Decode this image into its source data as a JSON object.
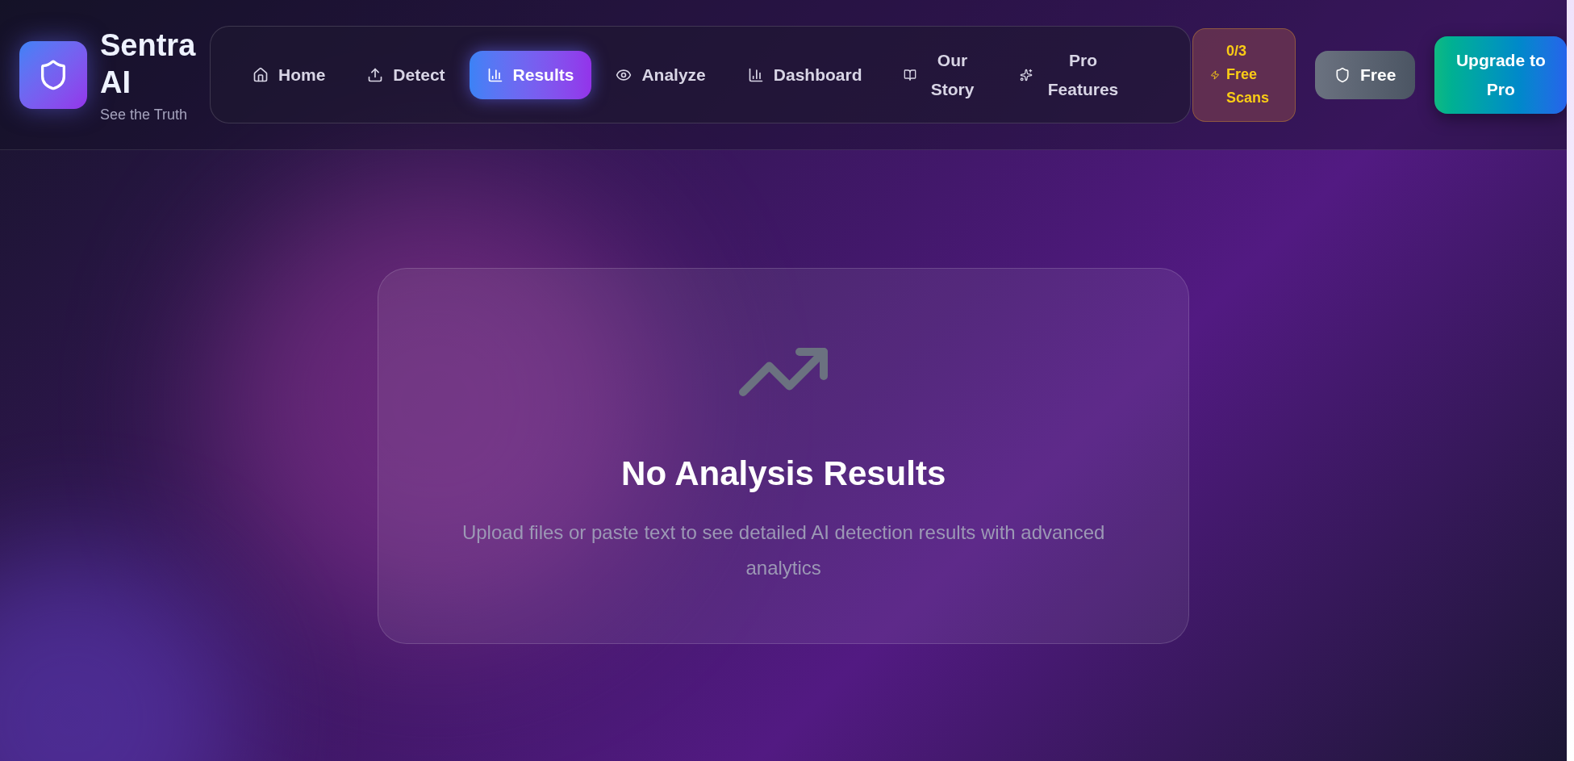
{
  "brand": {
    "name": "Sentra AI",
    "tagline": "See the Truth"
  },
  "nav": [
    {
      "label": "Home",
      "selected": false
    },
    {
      "label": "Detect",
      "selected": false
    },
    {
      "label": "Results",
      "selected": true
    },
    {
      "label": "Analyze",
      "selected": false
    },
    {
      "label": "Dashboard",
      "selected": false
    },
    {
      "label": "Our Story",
      "selected": false
    },
    {
      "label": "Pro Features",
      "selected": false
    }
  ],
  "scans_badge": "0/3 Free Scans",
  "plan_button": "Free",
  "upgrade_button": "Upgrade to Pro",
  "empty_state": {
    "title": "No Analysis Results",
    "message": "Upload files or paste text to see detailed AI detection results with advanced analytics"
  }
}
